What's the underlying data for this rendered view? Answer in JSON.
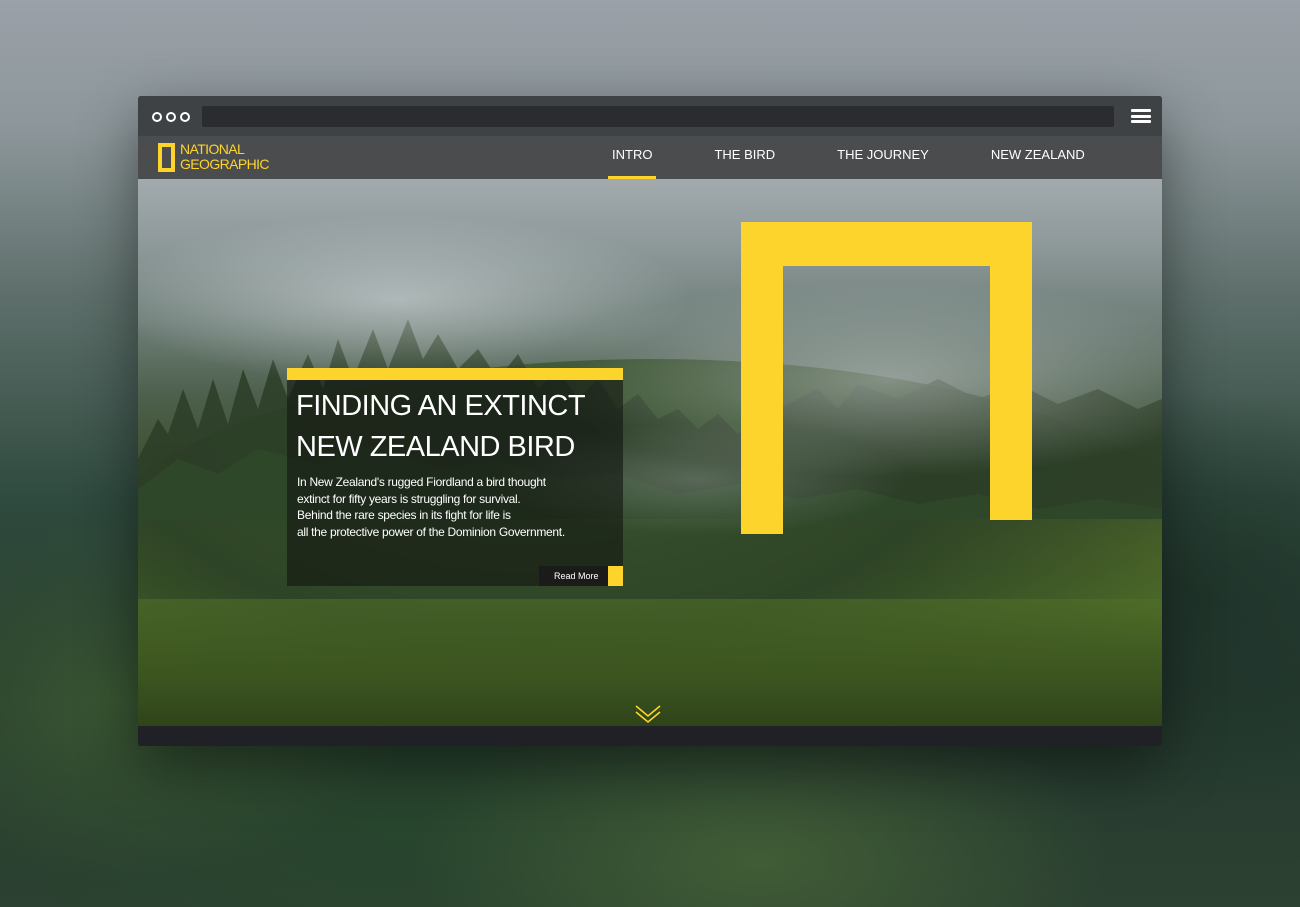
{
  "browser": {
    "window_controls": [
      "dot",
      "dot",
      "dot"
    ],
    "menu_icon": "hamburger-icon"
  },
  "brand": {
    "line1": "National",
    "line2": "Geographic",
    "color": "#ffd42a"
  },
  "nav": {
    "items": [
      {
        "label": "INTRO",
        "active": true
      },
      {
        "label": "THE BIRD",
        "active": false
      },
      {
        "label": "THE JOURNEY",
        "active": false
      },
      {
        "label": "NEW ZEALAND",
        "active": false
      }
    ]
  },
  "hero": {
    "title_line1": "FINDING AN EXTINCT",
    "title_line2": "NEW ZEALAND BIRD",
    "body_lines": [
      "In New Zealand's rugged Fiordland a bird thought",
      "extinct for fifty years is struggling for survival.",
      "Behind the rare species in its fight for life is",
      "all the protective power of the Dominion Government."
    ],
    "read_more_label": "Read More",
    "scroll_icon": "double-chevron-down-icon"
  },
  "colors": {
    "accent": "#fdd42b",
    "navbar": "#4a4c4d",
    "chrome": "#3f4244"
  }
}
